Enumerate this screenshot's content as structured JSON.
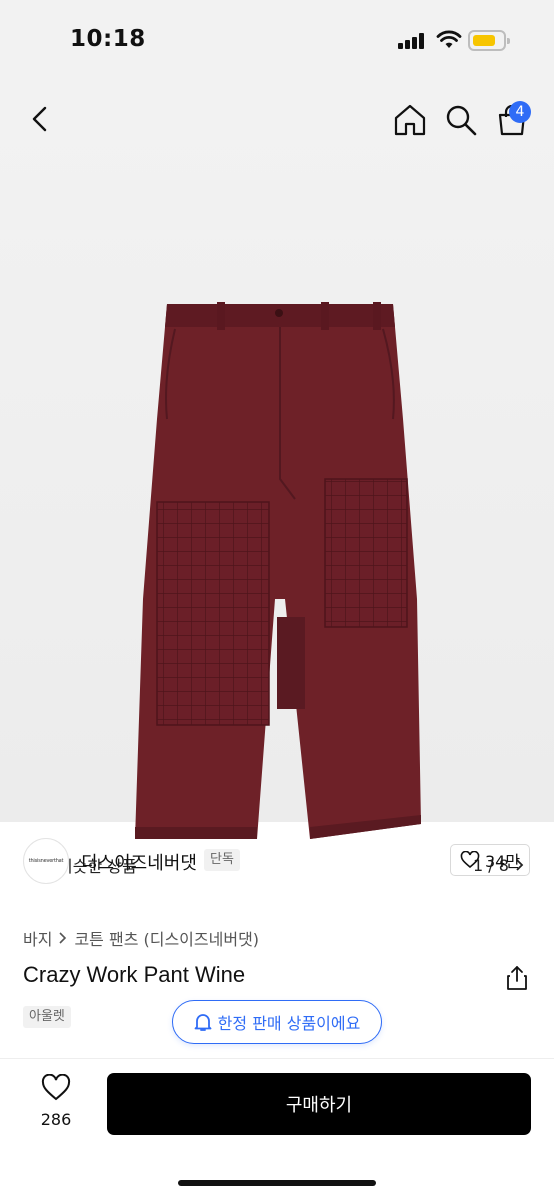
{
  "status_bar": {
    "time": "10:18"
  },
  "header": {
    "cart_count": "4"
  },
  "gallery": {
    "similar_label": "비슷한 상품",
    "page_indicator": "1 / 8"
  },
  "brand": {
    "logo_text": "thisisneverthat",
    "name": "디스이즈네버댓",
    "tag": "단독",
    "likes": "34만"
  },
  "breadcrumb": {
    "category": "바지",
    "subcategory": "코튼 팬츠 (디스이즈네버댓)"
  },
  "product": {
    "title": "Crazy Work Pant Wine",
    "tag": "아울렛",
    "limited_label": "한정 판매 상품이에요"
  },
  "bottom": {
    "wish_count": "286",
    "buy_label": "구매하기"
  },
  "colors": {
    "accent": "#2f6cf6",
    "buy_button": "#000000",
    "product": "#6e2128",
    "battery": "#f7c500"
  }
}
